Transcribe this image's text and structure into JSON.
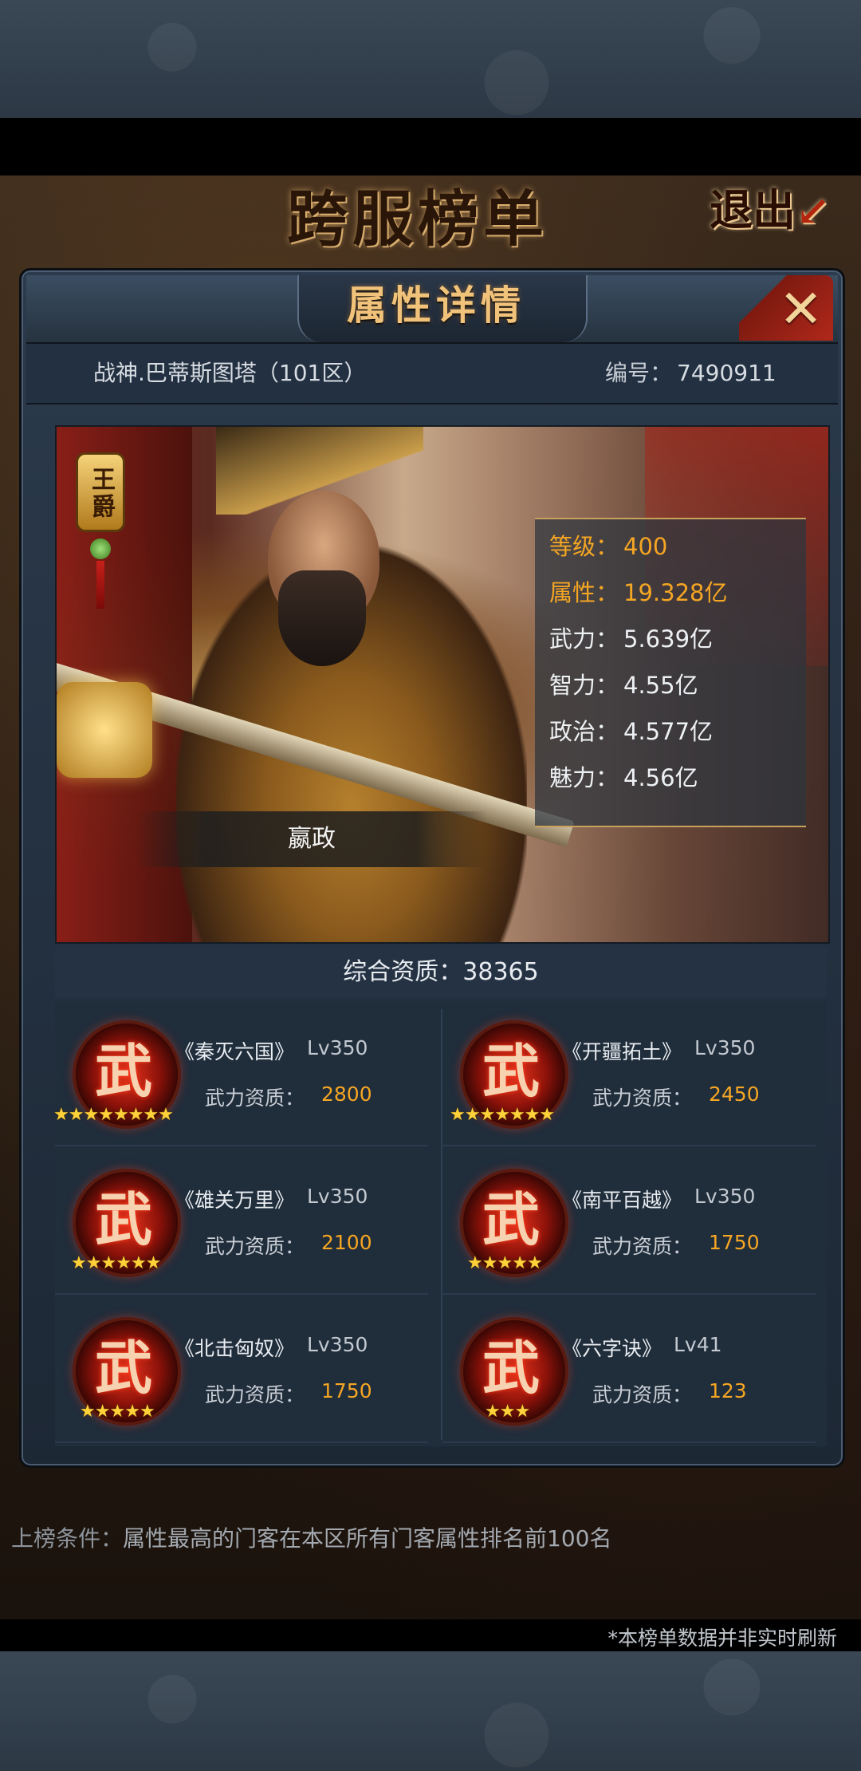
{
  "board": {
    "title": "跨服榜单",
    "exit_label": "退出",
    "exit_arrow": "↙"
  },
  "panel": {
    "title": "属性详情",
    "close_icon": "✕",
    "hero_name": "战神.巴蒂斯图塔（101区）",
    "id_label": "编号：",
    "id_value": "7490911"
  },
  "hero": {
    "rank_title": "王爵",
    "name": "嬴政",
    "stats": [
      {
        "label": "等级：",
        "value": "400",
        "highlight": true
      },
      {
        "label": "属性：",
        "value": "19.328亿",
        "highlight": true
      },
      {
        "label": "武力：",
        "value": "5.639亿",
        "highlight": false
      },
      {
        "label": "智力：",
        "value": "4.55亿",
        "highlight": false
      },
      {
        "label": "政治：",
        "value": "4.577亿",
        "highlight": false
      },
      {
        "label": "魅力：",
        "value": "4.56亿",
        "highlight": false
      }
    ]
  },
  "aptitude": {
    "label": "综合资质：",
    "value": "38365"
  },
  "skills": [
    {
      "icon_char": "武",
      "name": "《秦灭六国》",
      "level": "Lv350",
      "attr_label": "武力资质：",
      "attr_value": "2800",
      "stars": 8
    },
    {
      "icon_char": "武",
      "name": "《开疆拓土》",
      "level": "Lv350",
      "attr_label": "武力资质：",
      "attr_value": "2450",
      "stars": 7
    },
    {
      "icon_char": "武",
      "name": "《雄关万里》",
      "level": "Lv350",
      "attr_label": "武力资质：",
      "attr_value": "2100",
      "stars": 6
    },
    {
      "icon_char": "武",
      "name": "《南平百越》",
      "level": "Lv350",
      "attr_label": "武力资质：",
      "attr_value": "1750",
      "stars": 5
    },
    {
      "icon_char": "武",
      "name": "《北击匈奴》",
      "level": "Lv350",
      "attr_label": "武力资质：",
      "attr_value": "1750",
      "stars": 5
    },
    {
      "icon_char": "武",
      "name": "《六字诀》",
      "level": "Lv41",
      "attr_label": "武力资质：",
      "attr_value": "123",
      "stars": 3
    }
  ],
  "condition": {
    "label": "上榜条件：",
    "text": "属性最高的门客在本区所有门客属性排名前100名"
  },
  "footnote": "*本榜单数据并非实时刷新",
  "colors": {
    "highlight": "#f5a623",
    "star": "#ffd23a",
    "title_gold": "#f1c27a",
    "close_red": "#b0281a"
  }
}
